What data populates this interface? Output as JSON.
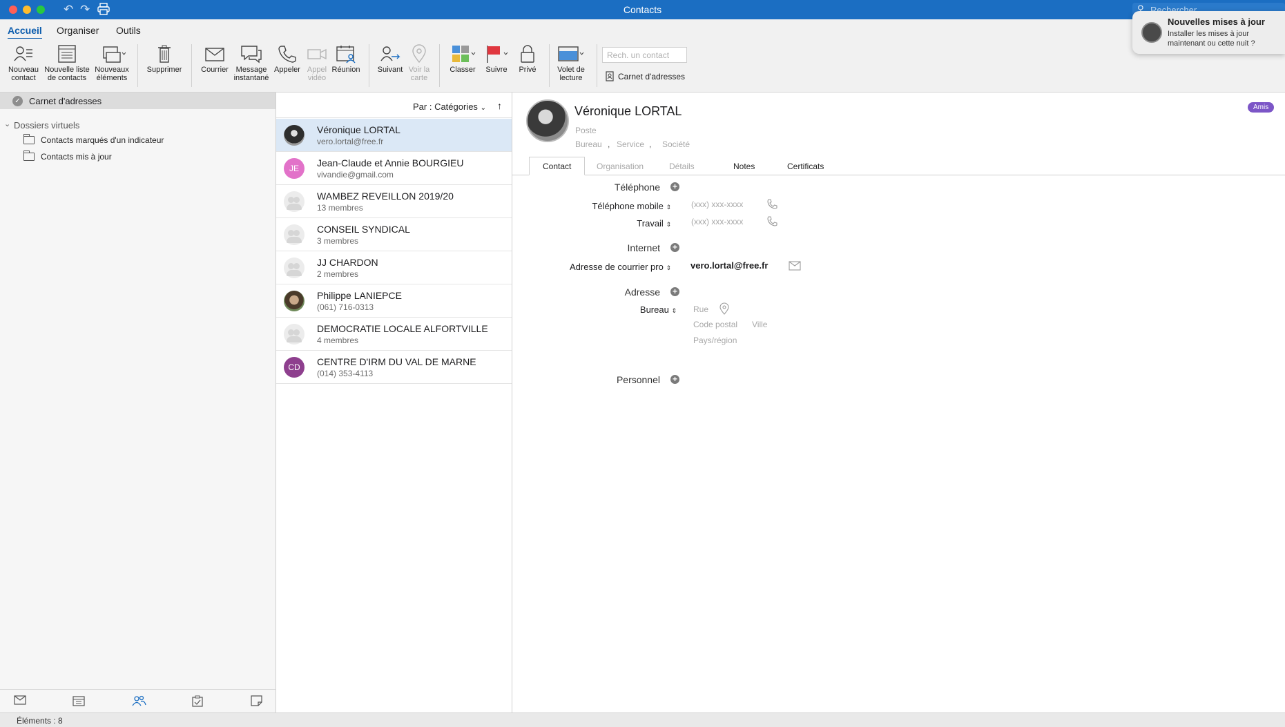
{
  "window": {
    "title": "Contacts",
    "search_placeholder": "Rechercher"
  },
  "ribbon_tabs": [
    "Accueil",
    "Organiser",
    "Outils"
  ],
  "ribbon": {
    "new_contact": [
      "Nouveau",
      "contact"
    ],
    "new_list": [
      "Nouvelle liste",
      "de contacts"
    ],
    "new_items": [
      "Nouveaux",
      "éléments"
    ],
    "delete": "Supprimer",
    "mail": "Courrier",
    "instant_message": [
      "Message",
      "instantané"
    ],
    "call": "Appeler",
    "video_call": [
      "Appel",
      "vidéo"
    ],
    "meeting": "Réunion",
    "follow": "Suivant",
    "map": [
      "Voir la",
      "carte"
    ],
    "categorize": "Classer",
    "follow_up": "Suivre",
    "private": "Privé",
    "reading_pane": [
      "Volet de",
      "lecture"
    ],
    "contact_search_placeholder": "Rech. un contact",
    "address_book": "Carnet d'adresses"
  },
  "notification": {
    "title": "Nouvelles mises à jour",
    "body": "Installer les mises à jour maintenant ou cette nuit ?"
  },
  "sidebar": {
    "root": "Carnet d'adresses",
    "group": "Dossiers virtuels",
    "folders": [
      "Contacts marqués d'un indicateur",
      "Contacts mis à jour"
    ]
  },
  "list": {
    "sort_label": "Par : Catégories",
    "contacts": [
      {
        "name": "Véronique LORTAL",
        "sub": "vero.lortal@free.fr",
        "type": "photo"
      },
      {
        "name": "Jean-Claude et Annie BOURGIEU",
        "sub": "vivandie@gmail.com",
        "type": "initials",
        "initials": "JE",
        "color": "#e272c9"
      },
      {
        "name": "WAMBEZ REVEILLON 2019/20",
        "sub": "13 membres",
        "type": "group"
      },
      {
        "name": "CONSEIL SYNDICAL",
        "sub": "3 membres",
        "type": "group"
      },
      {
        "name": "JJ CHARDON",
        "sub": "2 membres",
        "type": "group"
      },
      {
        "name": "Philippe LANIEPCE",
        "sub": "(061) 716-0313",
        "type": "photo2"
      },
      {
        "name": "DEMOCRATIE LOCALE ALFORTVILLE",
        "sub": "4 membres",
        "type": "group"
      },
      {
        "name": "CENTRE D'IRM DU VAL DE MARNE",
        "sub": "(014) 353-4113",
        "type": "initials",
        "initials": "CD",
        "color": "#8e3f8e"
      }
    ]
  },
  "detail": {
    "name": "Véronique  LORTAL",
    "badge": "Amis",
    "badge_color": "#7c56c7",
    "job_placeholder": "Poste",
    "office_placeholder": "Bureau",
    "service_placeholder": "Service",
    "company_placeholder": "Société",
    "tabs": [
      "Contact",
      "Organisation",
      "Détails",
      "Notes",
      "Certificats"
    ],
    "phone_section": "Téléphone",
    "mobile_label": "Téléphone mobile",
    "work_label": "Travail",
    "phone_placeholder": "(xxx) xxx-xxxx",
    "internet_section": "Internet",
    "email_label": "Adresse de courrier pro",
    "email_value": "vero.lortal@free.fr",
    "address_section": "Adresse",
    "address_label": "Bureau",
    "street_placeholder": "Rue",
    "zip_placeholder": "Code postal",
    "city_placeholder": "Ville",
    "country_placeholder": "Pays/région",
    "personal_section": "Personnel"
  },
  "status": {
    "text": "Éléments : 8"
  }
}
